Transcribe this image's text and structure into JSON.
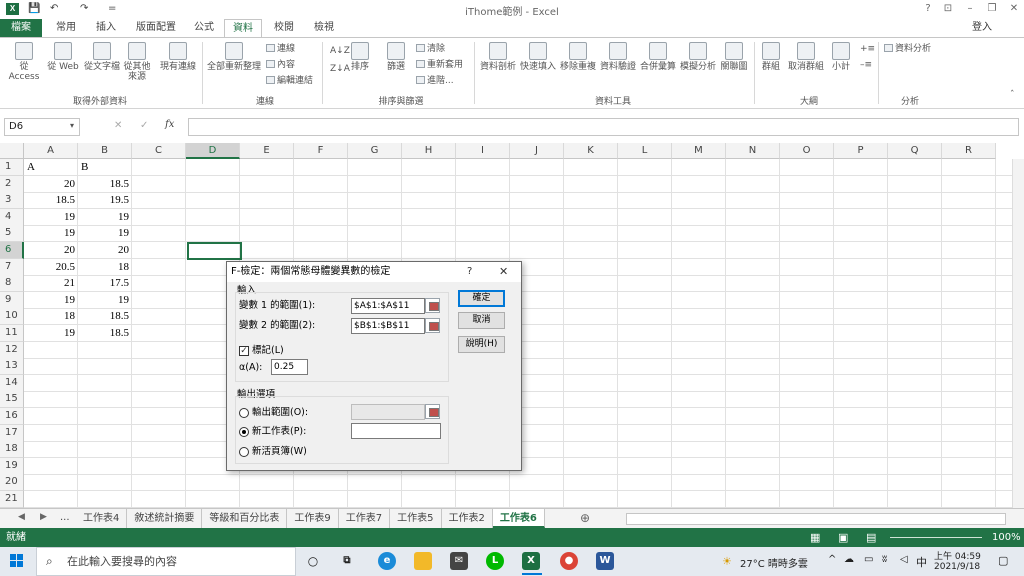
{
  "window": {
    "title": "iThome範例 - Excel",
    "user": "登入",
    "help": "?"
  },
  "qat": {
    "save": "💾",
    "undo": "↶",
    "redo": "↷",
    "more": "="
  },
  "tabs": [
    "檔案",
    "常用",
    "插入",
    "版面配置",
    "公式",
    "資料",
    "校閱",
    "檢視"
  ],
  "active_tab": "資料",
  "ribbon": {
    "external": {
      "from_access": "從 Access",
      "from_web": "從 Web",
      "from_text": "從文字檔",
      "from_other": "從其他\n來源",
      "existing": "現有連線",
      "group": "取得外部資料"
    },
    "connections": {
      "refresh_all": "全部重新整理",
      "connections": "連線",
      "properties": "內容",
      "edit_links": "編輯連結",
      "group": "連線"
    },
    "sort": {
      "az": "A↓Z",
      "za": "Z↓A",
      "sort": "排序",
      "filter": "篩選",
      "clear": "清除",
      "reapply": "重新套用",
      "advanced": "進階...",
      "group": "排序與篩選"
    },
    "tools": {
      "text_to_col": "資料剖析",
      "flash_fill": "快速填入",
      "remove_dup": "移除重複",
      "validation": "資料驗證",
      "consolidate": "合併彙算",
      "what_if": "模擬分析",
      "relationships": "關聯圖",
      "group": "資料工具"
    },
    "outline": {
      "group_btn": "群組",
      "ungroup": "取消群組",
      "subtotal": "小計",
      "group": "大綱"
    },
    "analysis": {
      "data_analysis": "資料分析",
      "group": "分析"
    }
  },
  "formula_bar": {
    "name_box": "D6",
    "fx": "fx",
    "cancel": "✕",
    "confirm": "✓",
    "content": ""
  },
  "columns": [
    "A",
    "B",
    "C",
    "D",
    "E",
    "F",
    "G",
    "H",
    "I",
    "J",
    "K",
    "L",
    "M",
    "N",
    "O",
    "P",
    "Q",
    "R"
  ],
  "rows": [
    "1",
    "2",
    "3",
    "4",
    "5",
    "6",
    "7",
    "8",
    "9",
    "10",
    "11",
    "12",
    "13",
    "14",
    "15",
    "16",
    "17",
    "18",
    "19",
    "20",
    "21"
  ],
  "cells": {
    "A": [
      "A",
      "20",
      "18.5",
      "19",
      "19",
      "20",
      "20.5",
      "21",
      "19",
      "18",
      "19"
    ],
    "B": [
      "B",
      "18.5",
      "19.5",
      "19",
      "19",
      "20",
      "18",
      "17.5",
      "19",
      "18.5",
      "18.5"
    ]
  },
  "sheet_tabs": [
    "工作表4",
    "敘述統計摘要",
    "等級和百分比表",
    "工作表9",
    "工作表7",
    "工作表5",
    "工作表2",
    "工作表6"
  ],
  "active_sheet": "工作表6",
  "sheet_nav": {
    "prev": "◀",
    "next": "▶",
    "more": "...",
    "add": "⊕"
  },
  "status": {
    "ready": "就緒",
    "zoom": "100%"
  },
  "dialog": {
    "title": "F-檢定：兩個常態母體變異數的檢定",
    "help": "?",
    "close": "✕",
    "input_label": "輸入",
    "range1_label": "變數 1 的範圍(1):",
    "range1_value": "$A$1:$A$11",
    "range2_label": "變數 2 的範圍(2):",
    "range2_value": "$B$1:$B$11",
    "labels_label": "標記(L)",
    "labels_checked": true,
    "alpha_label": "α(A):",
    "alpha_value": "0.25",
    "output_label": "輸出選項",
    "output_range": "輸出範圍(O):",
    "new_sheet": "新工作表(P):",
    "new_workbook": "新活頁簿(W)",
    "ok": "確定",
    "cancel": "取消",
    "help_btn": "說明(H)"
  },
  "taskbar": {
    "search_placeholder": "在此輸入要搜尋的內容",
    "weather": "27°C 晴時多雲",
    "ime": "中",
    "time": "上午 04:59",
    "date": "2021/9/18"
  }
}
